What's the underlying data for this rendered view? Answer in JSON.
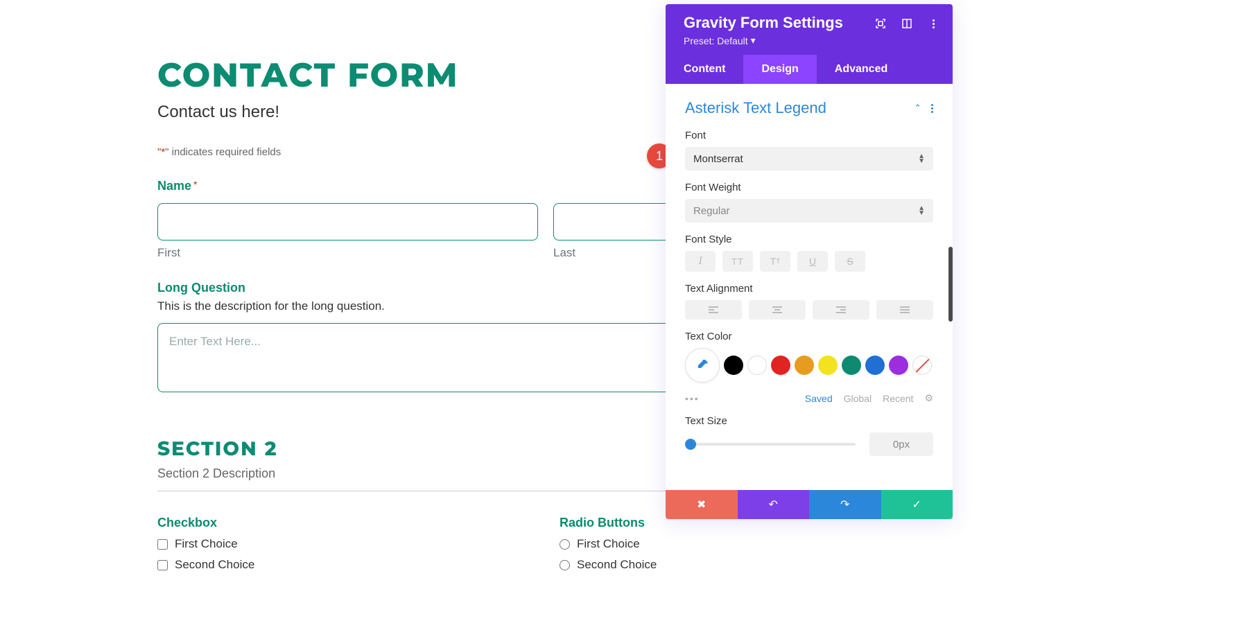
{
  "form": {
    "title": "CONTACT FORM",
    "subtitle": "Contact us here!",
    "required_note_prefix": "\"",
    "required_note_asterisk": "*",
    "required_note_suffix": "\" indicates required fields",
    "name": {
      "label": "Name",
      "first": "First",
      "last": "Last"
    },
    "long_q": {
      "label": "Long Question",
      "desc": "This is the description for the long question.",
      "placeholder": "Enter Text Here..."
    },
    "section2": {
      "title": "SECTION 2",
      "desc": "Section 2 Description"
    },
    "checkbox": {
      "label": "Checkbox",
      "opts": [
        "First Choice",
        "Second Choice"
      ]
    },
    "radio": {
      "label": "Radio Buttons",
      "opts": [
        "First Choice",
        "Second Choice"
      ]
    }
  },
  "badge": "1",
  "panel": {
    "title": "Gravity Form Settings",
    "preset": "Preset: Default",
    "tabs": {
      "content": "Content",
      "design": "Design",
      "advanced": "Advanced"
    },
    "section": "Asterisk Text Legend",
    "font": {
      "label": "Font",
      "value": "Montserrat"
    },
    "weight": {
      "label": "Font Weight",
      "value": "Regular"
    },
    "style": {
      "label": "Font Style"
    },
    "align": {
      "label": "Text Alignment"
    },
    "color": {
      "label": "Text Color",
      "swatches": [
        "#000000",
        "#ffffff",
        "#e02424",
        "#e89c1f",
        "#f2e21f",
        "#0d8a70",
        "#1f6fd4",
        "#9b2fe0"
      ],
      "sub": {
        "saved": "Saved",
        "global": "Global",
        "recent": "Recent"
      }
    },
    "size": {
      "label": "Text Size",
      "value": "0px"
    }
  }
}
